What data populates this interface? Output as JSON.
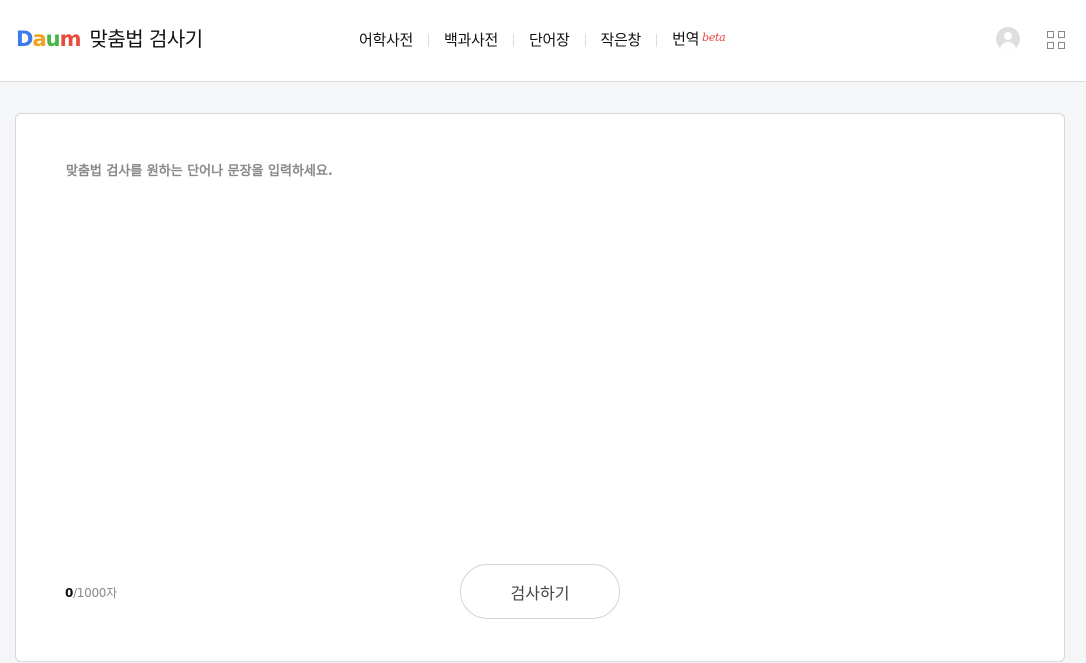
{
  "header": {
    "logo_letters": [
      "D",
      "a",
      "u",
      "m"
    ],
    "logo_colors": [
      "#3d7ce8",
      "#f4a21c",
      "#43b648",
      "#e84c3d"
    ],
    "title": "맞춤법 검사기"
  },
  "nav": {
    "items": [
      {
        "label": "어학사전"
      },
      {
        "label": "백과사전"
      },
      {
        "label": "단어장"
      },
      {
        "label": "작은창"
      },
      {
        "label": "번역",
        "badge": "beta"
      }
    ]
  },
  "utility": {
    "profile_icon": "user-avatar-icon",
    "apps_icon": "grid-menu-icon"
  },
  "editor": {
    "value": "",
    "placeholder": "맞춤법 검사를 원하는 단어나 문장을 입력하세요."
  },
  "counter": {
    "current": "0",
    "limit": "/1000자"
  },
  "actions": {
    "check_label": "검사하기"
  }
}
